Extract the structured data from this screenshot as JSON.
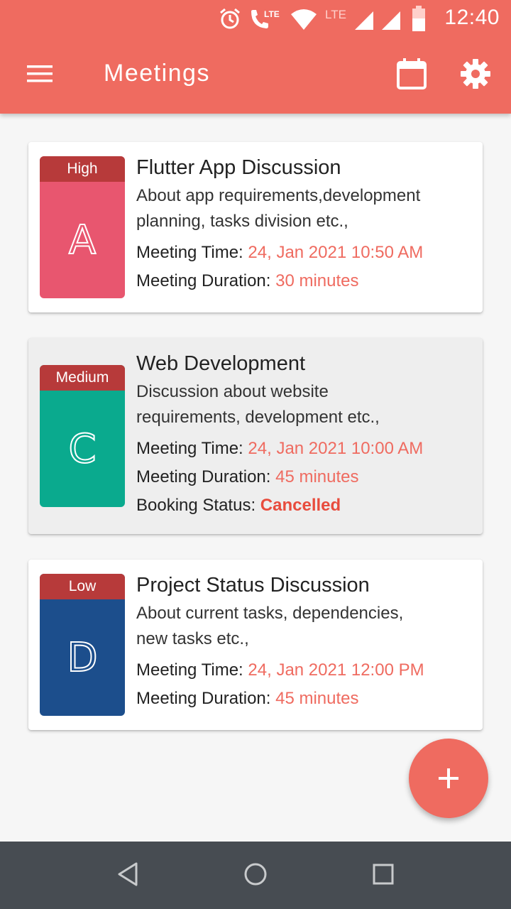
{
  "status_bar": {
    "time": "12:40",
    "icons": [
      "alarm-icon",
      "lte-call-icon",
      "wifi-icon",
      "lte-icon",
      "signal-icon",
      "signal-icon",
      "battery-icon"
    ],
    "lte_label_1": "LTE",
    "lte_label_2": "LTE"
  },
  "toolbar": {
    "title": "Meetings",
    "menu_icon": "menu-icon",
    "calendar_icon": "calendar-icon",
    "settings_icon": "gear-icon",
    "color": "#ef6b60"
  },
  "meetings": [
    {
      "priority": "High",
      "letter": "A",
      "color": "#e8566f",
      "title": "Flutter App Discussion",
      "description_line1": "About app requirements,development",
      "description_line2": "planning, tasks division etc.,",
      "time_label": "Meeting Time:",
      "time_value": "24, Jan 2021 10:50 AM",
      "duration_label": "Meeting Duration:",
      "duration_value": "30 minutes"
    },
    {
      "priority": "Medium",
      "letter": "C",
      "color": "#0aaa8e",
      "title": "Web Development",
      "description_line1": "Discussion about website",
      "description_line2": "requirements, development etc.,",
      "time_label": "Meeting Time:",
      "time_value": "24, Jan 2021 10:00 AM",
      "duration_label": "Meeting Duration:",
      "duration_value": "45 minutes",
      "status_label": "Booking Status:",
      "status_value": "Cancelled"
    },
    {
      "priority": "Low",
      "letter": "D",
      "color": "#1c4e8c",
      "title": "Project Status Discussion",
      "description_line1": "About current tasks, dependencies,",
      "description_line2": "new tasks etc.,",
      "time_label": "Meeting Time:",
      "time_value": "24, Jan 2021 12:00 PM",
      "duration_label": "Meeting Duration:",
      "duration_value": "45 minutes"
    }
  ],
  "fab": {
    "icon": "plus-icon"
  },
  "nav_bar": {
    "back_icon": "back-icon",
    "home_icon": "home-icon",
    "recents_icon": "recents-icon"
  },
  "colors": {
    "accent": "#ef6b60",
    "priority_bar": "#b73a3a",
    "nav_bar": "#474c52"
  }
}
